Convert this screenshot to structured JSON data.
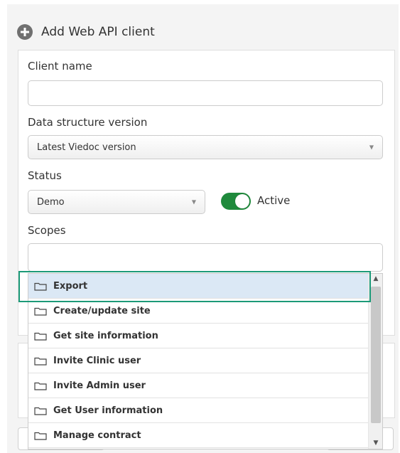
{
  "header": {
    "title": "Add Web API client"
  },
  "form": {
    "client_name": {
      "label": "Client name",
      "value": "",
      "placeholder": ""
    },
    "data_structure_version": {
      "label": "Data structure version",
      "selected": "Latest Viedoc version"
    },
    "status": {
      "label": "Status",
      "selected": "Demo"
    },
    "active_toggle": {
      "label": "Active",
      "checked": true
    },
    "scopes": {
      "label": "Scopes",
      "value": ""
    }
  },
  "scopes_dropdown": {
    "items": [
      {
        "label": "Export",
        "selected": true
      },
      {
        "label": "Create/update site",
        "selected": false
      },
      {
        "label": "Get site information",
        "selected": false
      },
      {
        "label": "Invite Clinic user",
        "selected": false
      },
      {
        "label": "Invite Admin user",
        "selected": false
      },
      {
        "label": "Get User information",
        "selected": false
      },
      {
        "label": "Manage contract",
        "selected": false
      }
    ]
  },
  "colors": {
    "toggle_on": "#1f8a3c",
    "highlight_border": "#1c9a78",
    "selected_item_bg": "#dbe8f5"
  }
}
